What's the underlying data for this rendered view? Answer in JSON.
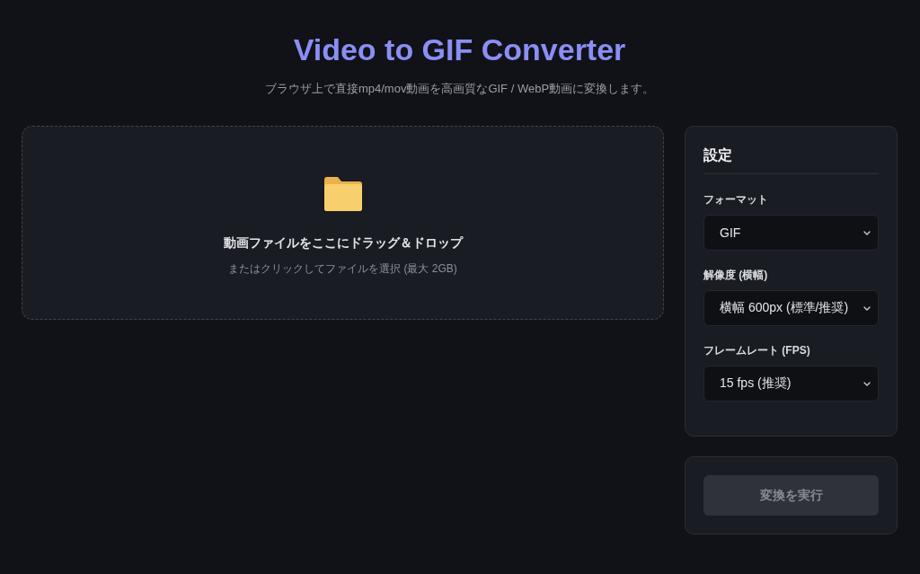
{
  "header": {
    "title": "Video to GIF Converter",
    "subtitle": "ブラウザ上で直接mp4/mov動画を高画質なGIF / WebP動画に変換します。"
  },
  "dropzone": {
    "heading": "動画ファイルをここにドラッグ＆ドロップ",
    "hint": "またはクリックしてファイルを選択 (最大 2GB)"
  },
  "settings": {
    "title": "設定",
    "fields": [
      {
        "label": "フォーマット",
        "value": "GIF"
      },
      {
        "label": "解像度 (横幅)",
        "value": "横幅 600px (標準/推奨)"
      },
      {
        "label": "フレームレート (FPS)",
        "value": "15 fps (推奨)"
      }
    ]
  },
  "convert_button": {
    "label": "変換を実行",
    "disabled": true
  }
}
